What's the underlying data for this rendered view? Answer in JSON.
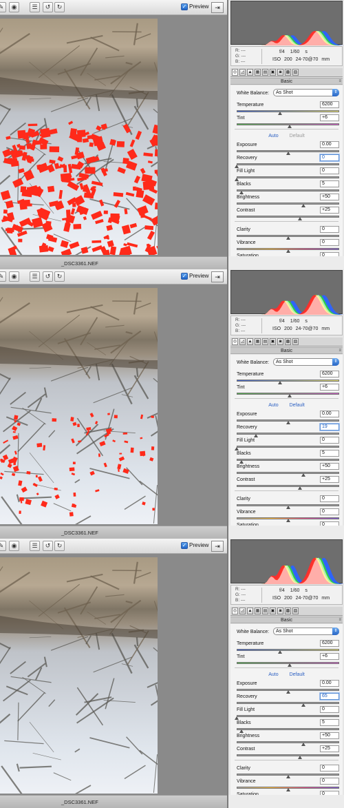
{
  "panels": [
    {
      "highlight": "high",
      "toolbar": {
        "preview_label": "Preview",
        "preview_checked": "✓"
      },
      "filename": "_DSC3361.NEF",
      "camera": {
        "rgb_r": "R:  ---",
        "rgb_g": "G:  ---",
        "rgb_b": "B:  ---",
        "aperture": "f/4",
        "shutter": "1/60 s",
        "iso": "ISO 200",
        "lens": "24-70@70 mm"
      },
      "basic_header": "Basic",
      "white_balance": {
        "label": "White Balance:",
        "value": "As Shot"
      },
      "auto_label": "Auto",
      "default_label": "Default",
      "default_enabled": false,
      "sliders": {
        "temperature": {
          "label": "Temperature",
          "value": "6200",
          "level": 0.42
        },
        "tint": {
          "label": "Tint",
          "value": "+6",
          "level": 0.52
        },
        "exposure": {
          "label": "Exposure",
          "value": "0.00",
          "level": 0.5
        },
        "recovery": {
          "label": "Recovery",
          "value": "0",
          "level": 0.0
        },
        "filllight": {
          "label": "Fill Light",
          "value": "0",
          "level": 0.0
        },
        "blacks": {
          "label": "Blacks",
          "value": "5",
          "level": 0.05
        },
        "brightness": {
          "label": "Brightness",
          "value": "+50",
          "level": 0.65
        },
        "contrast": {
          "label": "Contrast",
          "value": "+25",
          "level": 0.62
        },
        "clarity": {
          "label": "Clarity",
          "value": "0",
          "level": 0.5
        },
        "vibrance": {
          "label": "Vibrance",
          "value": "0",
          "level": 0.5
        },
        "saturation": {
          "label": "Saturation",
          "value": "0",
          "level": 0.5
        }
      }
    },
    {
      "highlight": "medium",
      "toolbar": {
        "preview_label": "Preview",
        "preview_checked": "✓"
      },
      "filename": "_DSC3361.NEF",
      "camera": {
        "rgb_r": "R:  ---",
        "rgb_g": "G:  ---",
        "rgb_b": "B:  ---",
        "aperture": "f/4",
        "shutter": "1/60 s",
        "iso": "ISO 200",
        "lens": "24-70@70 mm"
      },
      "basic_header": "Basic",
      "white_balance": {
        "label": "White Balance:",
        "value": "As Shot"
      },
      "auto_label": "Auto",
      "default_label": "Default",
      "default_enabled": true,
      "sliders": {
        "temperature": {
          "label": "Temperature",
          "value": "6200",
          "level": 0.42
        },
        "tint": {
          "label": "Tint",
          "value": "+6",
          "level": 0.52
        },
        "exposure": {
          "label": "Exposure",
          "value": "0.00",
          "level": 0.5
        },
        "recovery": {
          "label": "Recovery",
          "value": "19",
          "level": 0.19
        },
        "filllight": {
          "label": "Fill Light",
          "value": "0",
          "level": 0.0
        },
        "blacks": {
          "label": "Blacks",
          "value": "5",
          "level": 0.05
        },
        "brightness": {
          "label": "Brightness",
          "value": "+50",
          "level": 0.65
        },
        "contrast": {
          "label": "Contrast",
          "value": "+25",
          "level": 0.62
        },
        "clarity": {
          "label": "Clarity",
          "value": "0",
          "level": 0.5
        },
        "vibrance": {
          "label": "Vibrance",
          "value": "0",
          "level": 0.5
        },
        "saturation": {
          "label": "Saturation",
          "value": "0",
          "level": 0.5
        }
      }
    },
    {
      "highlight": "none",
      "toolbar": {
        "preview_label": "Preview",
        "preview_checked": "✓"
      },
      "filename": "_DSC3361.NEF",
      "camera": {
        "rgb_r": "R:  ---",
        "rgb_g": "G:  ---",
        "rgb_b": "B:  ---",
        "aperture": "f/4",
        "shutter": "1/60 s",
        "iso": "ISO 200",
        "lens": "24-70@70 mm"
      },
      "basic_header": "Basic",
      "white_balance": {
        "label": "White Balance:",
        "value": "As Shot"
      },
      "auto_label": "Auto",
      "default_label": "Default",
      "default_enabled": true,
      "sliders": {
        "temperature": {
          "label": "Temperature",
          "value": "6200",
          "level": 0.42
        },
        "tint": {
          "label": "Tint",
          "value": "+6",
          "level": 0.52
        },
        "exposure": {
          "label": "Exposure",
          "value": "0.00",
          "level": 0.5
        },
        "recovery": {
          "label": "Recovery",
          "value": "65",
          "level": 0.65
        },
        "filllight": {
          "label": "Fill Light",
          "value": "0",
          "level": 0.0
        },
        "blacks": {
          "label": "Blacks",
          "value": "5",
          "level": 0.05
        },
        "brightness": {
          "label": "Brightness",
          "value": "+50",
          "level": 0.65
        },
        "contrast": {
          "label": "Contrast",
          "value": "+25",
          "level": 0.62
        },
        "clarity": {
          "label": "Clarity",
          "value": "0",
          "level": 0.5
        },
        "vibrance": {
          "label": "Vibrance",
          "value": "0",
          "level": 0.5
        },
        "saturation": {
          "label": "Saturation",
          "value": "0",
          "level": 0.5
        }
      }
    }
  ],
  "colors": {
    "clipping_overlay": "#ff2a1a",
    "accent_blue": "#2a5fc2",
    "canvas_gray": "#8a8a8a"
  }
}
